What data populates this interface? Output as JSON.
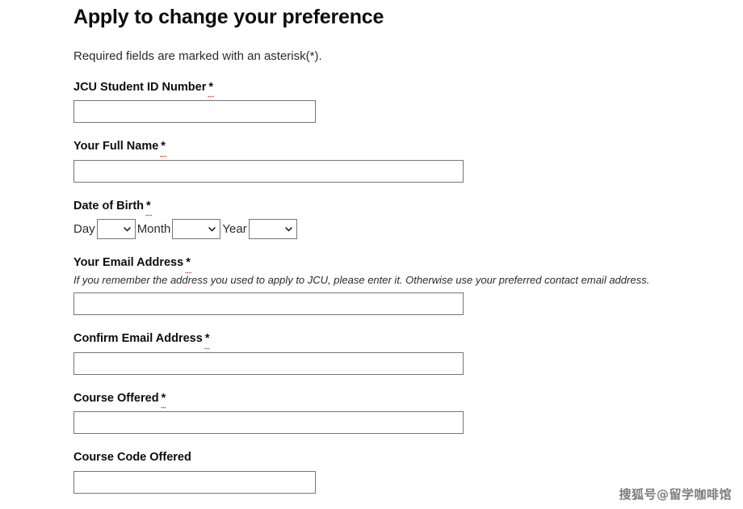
{
  "form": {
    "title": "Apply to change your preference",
    "intro": "Required fields are marked with an asterisk(*).",
    "required_marker": "*",
    "fields": [
      {
        "label": "JCU Student ID Number",
        "required": true,
        "type": "text",
        "value": "",
        "width": "narrow"
      },
      {
        "label": "Your Full Name",
        "required": true,
        "type": "text",
        "value": "",
        "width": "wide"
      },
      {
        "label": "Date of Birth",
        "required": true,
        "type": "date-selects",
        "day_label": "Day",
        "month_label": "Month",
        "year_label": "Year",
        "day_value": "",
        "month_value": "",
        "year_value": ""
      },
      {
        "label": "Your Email Address",
        "required": true,
        "type": "text",
        "help": "If you remember the address you used to apply to JCU, please enter it. Otherwise use your preferred contact email address.",
        "value": "",
        "width": "wide"
      },
      {
        "label": "Confirm Email Address",
        "required": true,
        "type": "text",
        "value": "",
        "width": "wide"
      },
      {
        "label": "Course Offered",
        "required": true,
        "type": "text",
        "value": "",
        "width": "wide"
      },
      {
        "label": "Course Code Offered",
        "required": false,
        "type": "text",
        "value": "",
        "width": "narrow"
      }
    ]
  },
  "watermark": {
    "text": "搜狐号@留学咖啡馆"
  },
  "colors": {
    "text": "#1b1b1b",
    "heading": "#0d0d0d",
    "input_border": "#767676",
    "spellcheck_underline": "#c23b22",
    "background": "#ffffff"
  }
}
